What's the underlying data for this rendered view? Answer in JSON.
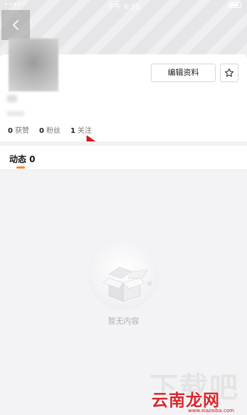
{
  "status_bar": {
    "signal": "••••• ",
    "time": "下午 6:20"
  },
  "header": {
    "back_icon": "chevron-left-icon"
  },
  "profile": {
    "edit_label": "编辑资料",
    "star_icon": "star-icon",
    "stats": [
      {
        "num": "0",
        "label": "获赞"
      },
      {
        "num": "0",
        "label": "粉丝"
      },
      {
        "num": "1",
        "label": "关注"
      }
    ]
  },
  "tabs": {
    "active_label": "动态 0",
    "accent_color": "#f08a2c"
  },
  "empty_state": {
    "text": "暂无内容",
    "icon": "empty-box-icon"
  },
  "watermark": {
    "ghost": "下载吧",
    "text": "云南龙网",
    "url": "www.xiazaiba.com"
  },
  "colors": {
    "arrow": "#e01818",
    "background": "#f3f3f5"
  }
}
